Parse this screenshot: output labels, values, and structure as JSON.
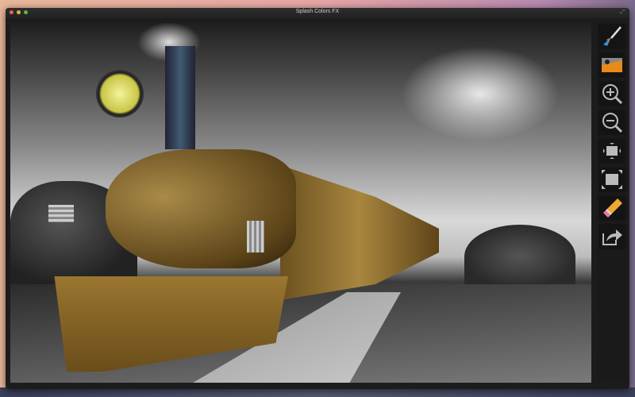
{
  "window": {
    "title": "Splash Colors FX"
  },
  "traffic_lights": {
    "close": "#ec5f56",
    "minimize": "#e0b638",
    "zoom": "#60b545"
  },
  "toolbar": {
    "tools": [
      {
        "name": "brush-tool",
        "icon": "paintbrush-icon"
      },
      {
        "name": "original-image-toggle",
        "icon": "image-preview-icon"
      },
      {
        "name": "zoom-in-button",
        "icon": "zoom-in-icon"
      },
      {
        "name": "zoom-out-button",
        "icon": "zoom-out-icon"
      },
      {
        "name": "fit-to-window-button",
        "icon": "fit-window-icon"
      },
      {
        "name": "full-screen-button",
        "icon": "fullscreen-icon"
      },
      {
        "name": "eraser-tool",
        "icon": "eraser-icon"
      },
      {
        "name": "share-button",
        "icon": "share-icon"
      }
    ]
  },
  "canvas": {
    "image": "steam locomotive with color splash"
  }
}
